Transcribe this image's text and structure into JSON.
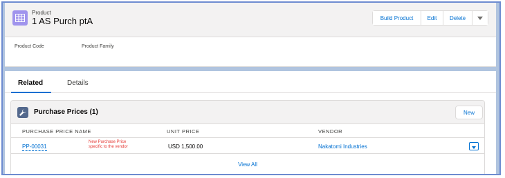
{
  "record": {
    "object_type": "Product",
    "name": "1 AS Purch ptA",
    "icon": "product-icon"
  },
  "actions": {
    "build_product": "Build Product",
    "edit": "Edit",
    "delete": "Delete",
    "more_icon": "chevron-down-icon"
  },
  "highlights": {
    "product_code_label": "Product Code",
    "product_family_label": "Product Family"
  },
  "tabs": {
    "related": "Related",
    "details": "Details",
    "active": "related"
  },
  "related_list": {
    "icon": "wrench-icon",
    "title": "Purchase Prices (1)",
    "new_label": "New",
    "columns": [
      "PURCHASE PRICE NAME",
      "UNIT PRICE",
      "VENDOR"
    ],
    "rows": [
      {
        "name": "PP-00031",
        "annotation_line1": "New Purchase Price",
        "annotation_line2": "specific to the vendor",
        "unit_price": "USD 1,500.00",
        "vendor": "Nakatomi Industries"
      }
    ],
    "view_all": "View All"
  },
  "colors": {
    "link": "#0070d2",
    "product_icon_bg": "#a094ed",
    "annotation": "#e53935",
    "frame_border": "#6d8bd0",
    "frame_bg": "#b0c4df"
  }
}
